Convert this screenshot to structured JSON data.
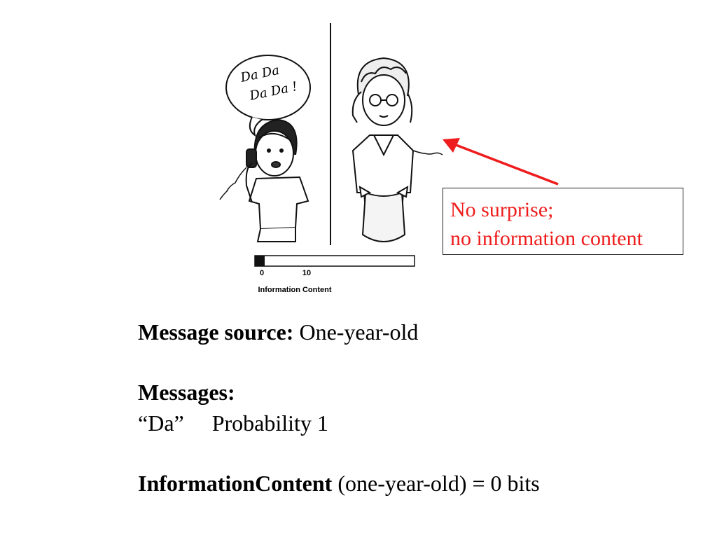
{
  "illustration": {
    "speech_bubble": [
      "Da Da",
      "Da Da !"
    ],
    "scale_ticks": [
      "0",
      "10"
    ],
    "scale_label": "Information Content",
    "scale_level": 0
  },
  "callout": {
    "line1": "No surprise;",
    "line2": "no information content",
    "color": "#ee1c1c"
  },
  "body": {
    "source_label": "Message source:",
    "source_value": "One-year-old",
    "messages_label": "Messages:",
    "message_text": "“Da”",
    "message_prob": "Probability 1",
    "ic_label": "InformationContent",
    "ic_value": "(one-year-old) = 0 bits"
  }
}
